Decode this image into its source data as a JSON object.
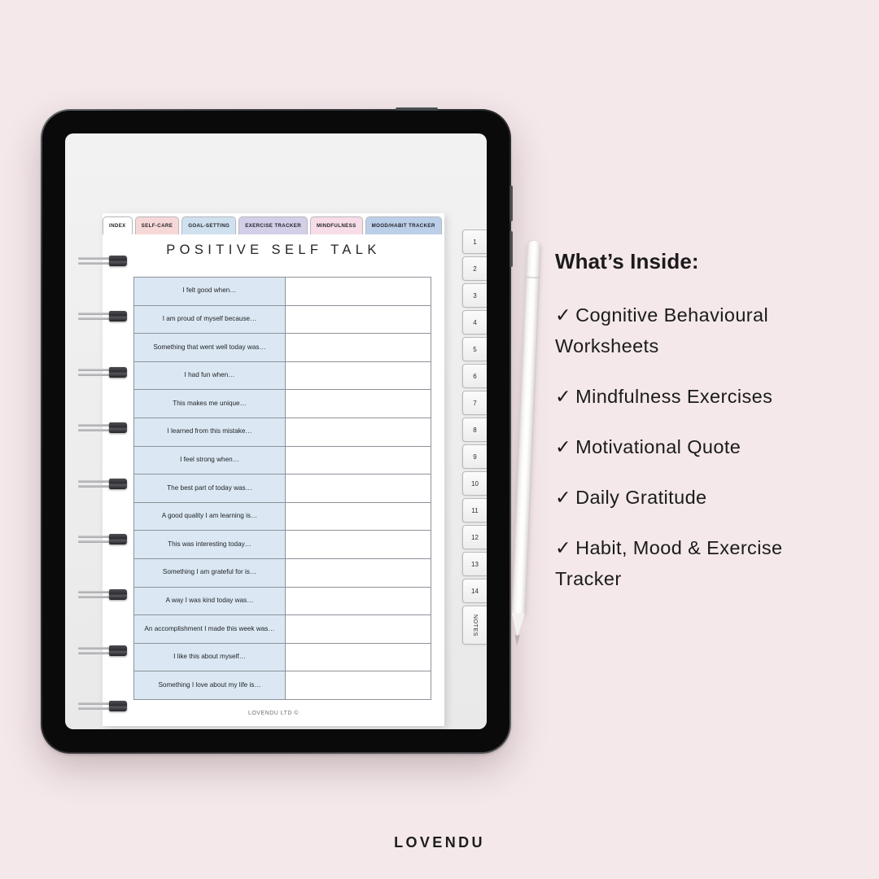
{
  "brand": {
    "footer_name": "LOVENDU",
    "page_copyright": "LOVENDU LTD ©"
  },
  "planner": {
    "page_title": "POSITIVE SELF TALK",
    "top_tabs": [
      {
        "label": "INDEX",
        "color": "#ffffff",
        "active": true
      },
      {
        "label": "SELF-CARE",
        "color": "#f7d8d8",
        "active": false
      },
      {
        "label": "GOAL-SETTING",
        "color": "#cfe1ef",
        "active": false
      },
      {
        "label": "EXERCISE TRACKER",
        "color": "#d3cfe8",
        "active": false
      },
      {
        "label": "MINDFULNESS",
        "color": "#f7dde8",
        "active": false
      },
      {
        "label": "MOOD/HABIT  TRACKER",
        "color": "#bccfe9",
        "active": false
      }
    ],
    "side_tabs": [
      "1",
      "2",
      "3",
      "4",
      "5",
      "6",
      "7",
      "8",
      "9",
      "10",
      "11",
      "12",
      "13",
      "14"
    ],
    "notes_tab_label": "NOTES",
    "prompts": [
      "I felt good when…",
      "I am proud of myself because…",
      "Something that went well today was…",
      "I had fun when…",
      "This makes me unique…",
      "I learned from this mistake…",
      "I feel strong when…",
      "The best part of today was…",
      "A good quality I am learning is…",
      "This was interesting today…",
      "Something I am grateful for is…",
      "A way I was kind today was…",
      "An accomplishment I made this week was…",
      "I like this about myself…",
      "Something I love about my life is…"
    ],
    "answer_values": [
      "",
      "",
      "",
      "",
      "",
      "",
      "",
      "",
      "",
      "",
      "",
      "",
      "",
      "",
      ""
    ],
    "prompt_cell_color": "#dbe8f3",
    "spiral_ring_count": 9
  },
  "inside_panel": {
    "heading": "What’s Inside:",
    "tick_glyph": "✓",
    "items": [
      "Cognitive Behavioural Worksheets",
      "Mindfulness Exercises",
      "Motivational Quote",
      "Daily Gratitude",
      "Habit, Mood & Exercise Tracker"
    ]
  },
  "theme": {
    "background": "#f4e8ea",
    "device_bezel": "#0a0a0a",
    "screen_background": "#ededed",
    "text_dark": "#1b1b1b"
  }
}
